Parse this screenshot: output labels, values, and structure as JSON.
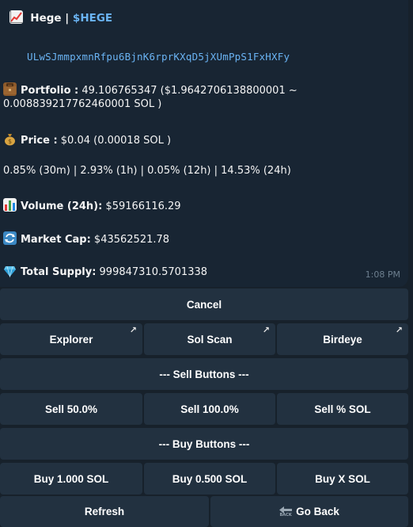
{
  "message": {
    "title_name": "Hege",
    "title_separator": " | ",
    "title_ticker": "$HEGE",
    "address": "ULwSJmmpxmnRfpu6BjnK6rprKXqD5jXUmPpS1FxHXFy",
    "portfolio_label": "Portfolio :",
    "portfolio_value_line1": " 49.106765347 ($1.9642706138800001 ~",
    "portfolio_value_line2": "0.008839217762460001 SOL )",
    "price_label": "Price :",
    "price_value": " $0.04 (0.00018 SOL )",
    "changes": "0.85% (30m) | 2.93% (1h) | 0.05% (12h) | 14.53% (24h)",
    "volume_label": "Volume (24h):",
    "volume_value": " $59166116.29",
    "marketcap_label": "Market Cap:",
    "marketcap_value": " $43562521.78",
    "supply_label": "Total Supply:",
    "supply_value": " 999847310.5701338",
    "time": "1:08 PM"
  },
  "keyboard": {
    "cancel": "Cancel",
    "explorer": "Explorer",
    "solscan": "Sol Scan",
    "birdeye": "Birdeye",
    "external_arrow": "↗",
    "sell_header": "--- Sell Buttons ---",
    "sell_50": "Sell 50.0%",
    "sell_100": "Sell 100.0%",
    "sell_pct_sol": "Sell % SOL",
    "buy_header": "--- Buy Buttons ---",
    "buy_1": "Buy 1.000 SOL",
    "buy_05": "Buy 0.500 SOL",
    "buy_x": "Buy X SOL",
    "refresh": "Refresh",
    "go_back": "Go Back",
    "back_icon_text": "BACK"
  },
  "icons": {
    "chart": "chart-increasing-icon",
    "briefcase": "briefcase-icon",
    "money_bag": "money-bag-icon",
    "bar_chart": "bar-chart-icon",
    "refresh": "refresh-arrows-icon",
    "gem": "gem-icon",
    "back": "back-arrow-icon"
  },
  "colors": {
    "background": "#17212b",
    "bubble": "#182533",
    "button": "#223140",
    "link": "#6ab3f3"
  }
}
